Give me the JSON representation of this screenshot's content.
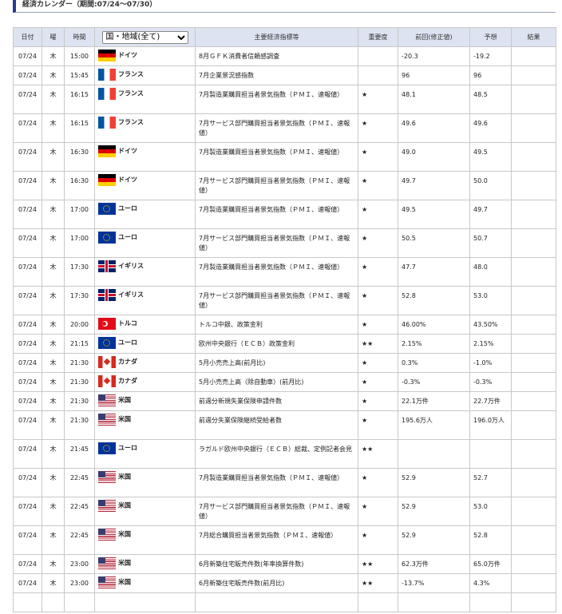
{
  "title": "経済カレンダー（期間:07/24～07/30）",
  "headers": {
    "date": "日付",
    "weekday": "曜",
    "time": "時間",
    "country_select": "国・地域(全て)",
    "indicator": "主要経済指標等",
    "importance": "重要度",
    "previous": "前回(修正値)",
    "forecast": "予想",
    "result": "結果"
  },
  "flag_colors": {
    "de": [
      "#000000",
      "#dd0000",
      "#ffce00"
    ],
    "fr": [
      "#0055a4",
      "#ffffff",
      "#ef4135"
    ],
    "eu": [
      "#003399",
      "#ffcc00"
    ],
    "gb": [
      "#012169",
      "#c8102e",
      "#ffffff"
    ],
    "tr": [
      "#e30a17",
      "#ffffff"
    ],
    "ca": [
      "#d52b1e",
      "#ffffff"
    ],
    "us": [
      "#b22234",
      "#ffffff",
      "#3c3b6e"
    ]
  },
  "rows": [
    {
      "date": "07/24",
      "wd": "木",
      "time": "15:00",
      "flag": "de",
      "country": "ドイツ",
      "indicator": "8月ＧＦＫ消費者信頼感調査",
      "imp": "",
      "prev": "-20.3",
      "fc": "-19.2",
      "res": "",
      "size": 1
    },
    {
      "date": "07/24",
      "wd": "木",
      "time": "15:45",
      "flag": "fr",
      "country": "フランス",
      "indicator": "7月企業景況感指数",
      "imp": "",
      "prev": "96",
      "fc": "96",
      "res": "",
      "size": 1
    },
    {
      "date": "07/24",
      "wd": "木",
      "time": "16:15",
      "flag": "fr",
      "country": "フランス",
      "indicator": "7月製造業購買担当者景気指数（ＰＭＩ、速報値）",
      "imp": "★",
      "prev": "48.1",
      "fc": "48.5",
      "res": "",
      "size": 2
    },
    {
      "date": "07/24",
      "wd": "木",
      "time": "16:15",
      "flag": "fr",
      "country": "フランス",
      "indicator": "7月サービス部門購買担当者景気指数（ＰＭＩ、速報値）",
      "imp": "★",
      "prev": "49.6",
      "fc": "49.6",
      "res": "",
      "size": 2
    },
    {
      "date": "07/24",
      "wd": "木",
      "time": "16:30",
      "flag": "de",
      "country": "ドイツ",
      "indicator": "7月製造業購買担当者景気指数（ＰＭＩ、速報値）",
      "imp": "★",
      "prev": "49.0",
      "fc": "49.5",
      "res": "",
      "size": 2
    },
    {
      "date": "07/24",
      "wd": "木",
      "time": "16:30",
      "flag": "de",
      "country": "ドイツ",
      "indicator": "7月サービス部門購買担当者景気指数（ＰＭＩ、速報値）",
      "imp": "★",
      "prev": "49.7",
      "fc": "50.0",
      "res": "",
      "size": 2
    },
    {
      "date": "07/24",
      "wd": "木",
      "time": "17:00",
      "flag": "eu",
      "country": "ユーロ",
      "indicator": "7月製造業購買担当者景気指数（ＰＭＩ、速報値）",
      "imp": "★",
      "prev": "49.5",
      "fc": "49.7",
      "res": "",
      "size": 2
    },
    {
      "date": "07/24",
      "wd": "木",
      "time": "17:00",
      "flag": "eu",
      "country": "ユーロ",
      "indicator": "7月サービス部門購買担当者景気指数（ＰＭＩ、速報値）",
      "imp": "★",
      "prev": "50.5",
      "fc": "50.7",
      "res": "",
      "size": 2
    },
    {
      "date": "07/24",
      "wd": "木",
      "time": "17:30",
      "flag": "gb",
      "country": "イギリス",
      "indicator": "7月製造業購買担当者景気指数（ＰＭＩ、速報値）",
      "imp": "★",
      "prev": "47.7",
      "fc": "48.0",
      "res": "",
      "size": 2
    },
    {
      "date": "07/24",
      "wd": "木",
      "time": "17:30",
      "flag": "gb",
      "country": "イギリス",
      "indicator": "7月サービス部門購買担当者景気指数（ＰＭＩ、速報値）",
      "imp": "★",
      "prev": "52.8",
      "fc": "53.0",
      "res": "",
      "size": 2
    },
    {
      "date": "07/24",
      "wd": "木",
      "time": "20:00",
      "flag": "tr",
      "country": "トルコ",
      "indicator": "トルコ中銀、政策金利",
      "imp": "★",
      "prev": "46.00%",
      "fc": "43.50%",
      "res": "",
      "size": 1
    },
    {
      "date": "07/24",
      "wd": "木",
      "time": "21:15",
      "flag": "eu",
      "country": "ユーロ",
      "indicator": "欧州中央銀行（ＥＣＢ）政策金利",
      "imp": "★★",
      "prev": "2.15%",
      "fc": "2.15%",
      "res": "",
      "size": 1
    },
    {
      "date": "07/24",
      "wd": "木",
      "time": "21:30",
      "flag": "ca",
      "country": "カナダ",
      "indicator": "5月小売売上高(前月比)",
      "imp": "★",
      "prev": "0.3%",
      "fc": "-1.0%",
      "res": "",
      "size": 1
    },
    {
      "date": "07/24",
      "wd": "木",
      "time": "21:30",
      "flag": "ca",
      "country": "カナダ",
      "indicator": "5月小売売上高（除自動車）(前月比)",
      "imp": "★",
      "prev": "-0.3%",
      "fc": "-0.3%",
      "res": "",
      "size": 1
    },
    {
      "date": "07/24",
      "wd": "木",
      "time": "21:30",
      "flag": "us",
      "country": "米国",
      "indicator": "前週分新規失業保険申請件数",
      "imp": "★",
      "prev": "22.1万件",
      "fc": "22.7万件",
      "res": "",
      "size": 1
    },
    {
      "date": "07/24",
      "wd": "木",
      "time": "21:30",
      "flag": "us",
      "country": "米国",
      "indicator": "前週分失業保険継続受給者数",
      "imp": "★",
      "prev": "195.6万人",
      "fc": "196.0万人",
      "res": "",
      "size": 2
    },
    {
      "date": "07/24",
      "wd": "木",
      "time": "21:45",
      "flag": "eu",
      "country": "ユーロ",
      "indicator": "ラガルド欧州中央銀行（ＥＣＢ）総裁、定例記者会見",
      "imp": "★★",
      "prev": "",
      "fc": "",
      "res": "",
      "size": 2
    },
    {
      "date": "07/24",
      "wd": "木",
      "time": "22:45",
      "flag": "us",
      "country": "米国",
      "indicator": "7月製造業購買担当者景気指数（ＰＭＩ、速報値）",
      "imp": "★",
      "prev": "52.9",
      "fc": "52.7",
      "res": "",
      "size": 2
    },
    {
      "date": "07/24",
      "wd": "木",
      "time": "22:45",
      "flag": "us",
      "country": "米国",
      "indicator": "7月サービス部門購買担当者景気指数（ＰＭＩ、速報値）",
      "imp": "★",
      "prev": "52.9",
      "fc": "53.0",
      "res": "",
      "size": 2
    },
    {
      "date": "07/24",
      "wd": "木",
      "time": "22:45",
      "flag": "us",
      "country": "米国",
      "indicator": "7月総合購買担当者景気指数（ＰＭＩ、速報値）",
      "imp": "★",
      "prev": "52.9",
      "fc": "52.8",
      "res": "",
      "size": 2
    },
    {
      "date": "07/24",
      "wd": "木",
      "time": "23:00",
      "flag": "us",
      "country": "米国",
      "indicator": "6月新築住宅販売件数(年率換算件数)",
      "imp": "★★",
      "prev": "62.3万件",
      "fc": "65.0万件",
      "res": "",
      "size": 1
    },
    {
      "date": "07/24",
      "wd": "木",
      "time": "23:00",
      "flag": "us",
      "country": "米国",
      "indicator": "6月新築住宅販売件数(前月比)",
      "imp": "★★",
      "prev": "-13.7%",
      "fc": "4.3%",
      "res": "",
      "size": 1
    },
    {
      "date": "",
      "wd": "",
      "time": "",
      "flag": "",
      "country": "",
      "indicator": "",
      "imp": "",
      "prev": "",
      "fc": "",
      "res": "",
      "size": 3
    }
  ]
}
